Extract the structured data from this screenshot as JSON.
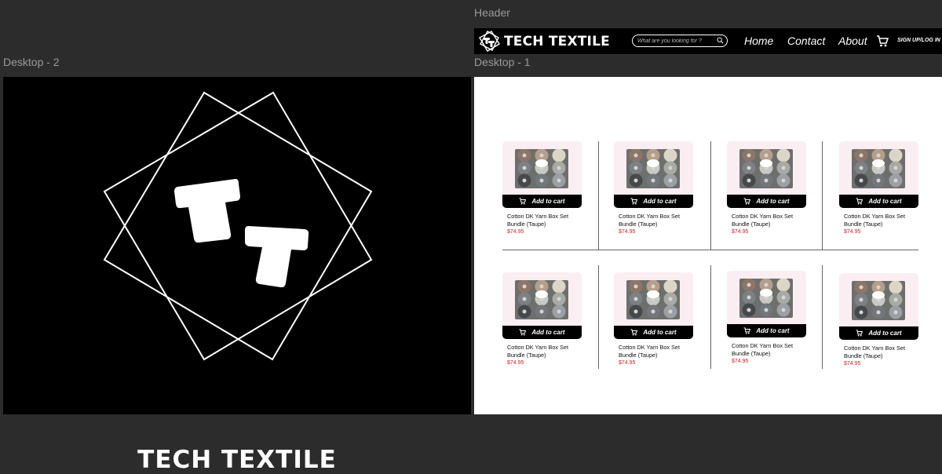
{
  "frames": {
    "header_label": "Header",
    "desktop2_label": "Desktop - 2",
    "desktop1_label": "Desktop - 1"
  },
  "logo_screen": {
    "brand_name": "TECH TEXTILE",
    "logo_letters": "TT"
  },
  "header": {
    "brand": "TECH TEXTILE",
    "search_placeholder": "What are you looking for ?",
    "nav": [
      "Home",
      "Contact",
      "About"
    ],
    "signup": "SIGN UP/LOG IN",
    "icons": [
      "search-icon",
      "shopping-cart-icon"
    ]
  },
  "products": [
    {
      "name": "Cotton DK Yarn Box Set Bundle (Taupe)",
      "price": "$74.95",
      "button": "Add to cart"
    },
    {
      "name": "Cotton DK Yarn Box Set Bundle (Taupe)",
      "price": "$74.95",
      "button": "Add to cart"
    },
    {
      "name": "Cotton DK Yarn Box Set Bundle (Taupe)",
      "price": "$74.95",
      "button": "Add to cart"
    },
    {
      "name": "Cotton DK Yarn Box Set Bundle (Taupe)",
      "price": "$74.95",
      "button": "Add to cart"
    },
    {
      "name": "Cotton DK Yarn Box Set Bundle (Taupe)",
      "price": "$74.95",
      "button": "Add to cart"
    },
    {
      "name": "Cotton DK Yarn Box Set Bundle (Taupe)",
      "price": "$74.95",
      "button": "Add to cart"
    },
    {
      "name": "Cotton DK Yarn Box Set Bundle (Taupe)",
      "price": "$74.95",
      "button": "Add to cart"
    },
    {
      "name": "Cotton DK Yarn Box Set Bundle (Taupe)",
      "price": "$74.95",
      "button": "Add to cart"
    }
  ],
  "colors": {
    "canvas": "#2c2c2c",
    "frame_label": "#9a9a9a",
    "price": "#d32020",
    "card_background": "#fbeef2",
    "button": "#000000"
  }
}
